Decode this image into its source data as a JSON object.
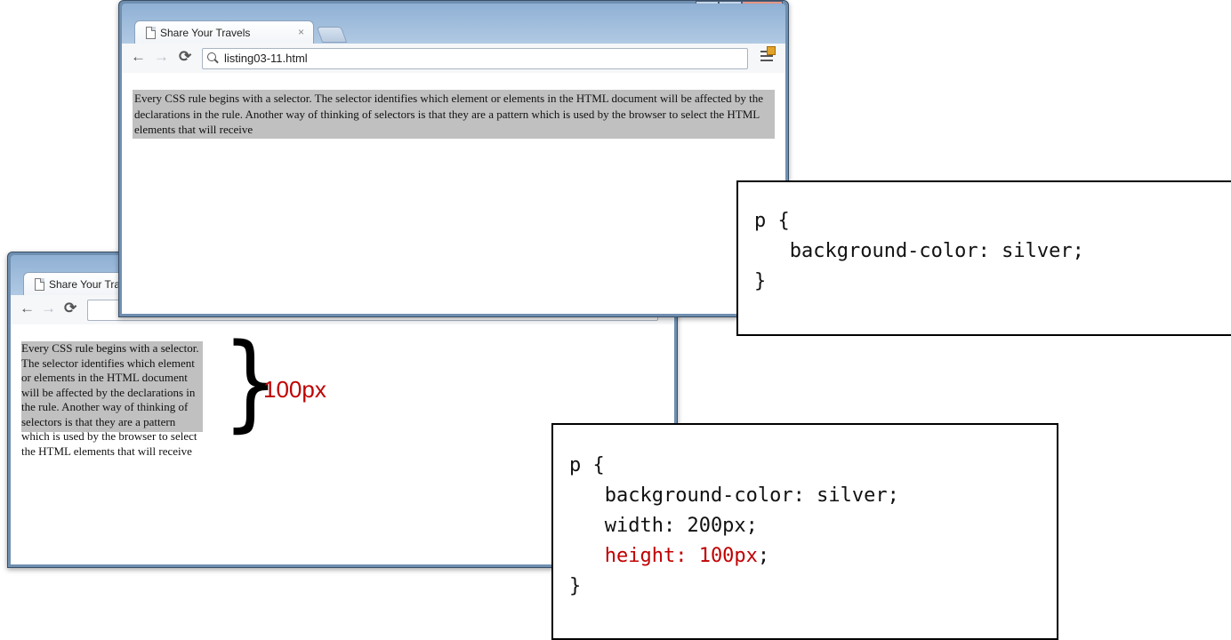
{
  "window_back": {
    "tab_title": "Share Your Travels",
    "paragraph": "Every CSS rule begins with a selector. The selector identifies which element or elements in the HTML document will be affected by the declarations in the rule. Another way of thinking of selectors is that they are a pattern which is used by the browser to select the HTML elements that will receive"
  },
  "window_front": {
    "tab_title": "Share Your Travels",
    "tab_close": "×",
    "url": "listing03-11.html",
    "paragraph": "Every CSS rule begins with a selector. The selector identifies which element or elements in the HTML document will be affected by the declarations in the rule. Another way of thinking of selectors is that they are a pattern which is used by the browser to select the HTML elements that will receive",
    "window_controls": {
      "minimize": "–",
      "maximize": "□",
      "close": "x"
    }
  },
  "annotation": {
    "brace": "}",
    "label": "100px",
    "label_color": "#c00000"
  },
  "code_top": {
    "lines": [
      "p {",
      "   background-color: silver;",
      "}"
    ]
  },
  "code_bottom": {
    "line1": "p {",
    "line2": "   background-color: silver;",
    "line3": "   width: 200px;",
    "line4": "   height: 100px",
    "line4_end": ";",
    "line5": "}"
  },
  "colors": {
    "paragraph_background": "#c0c0c0",
    "highlight": "#c00000"
  },
  "icons": {
    "back": "back-arrow-icon",
    "forward": "forward-arrow-icon",
    "reload": "reload-icon",
    "search": "search-icon",
    "page": "page-icon",
    "wrench": "wrench-menu-icon"
  }
}
